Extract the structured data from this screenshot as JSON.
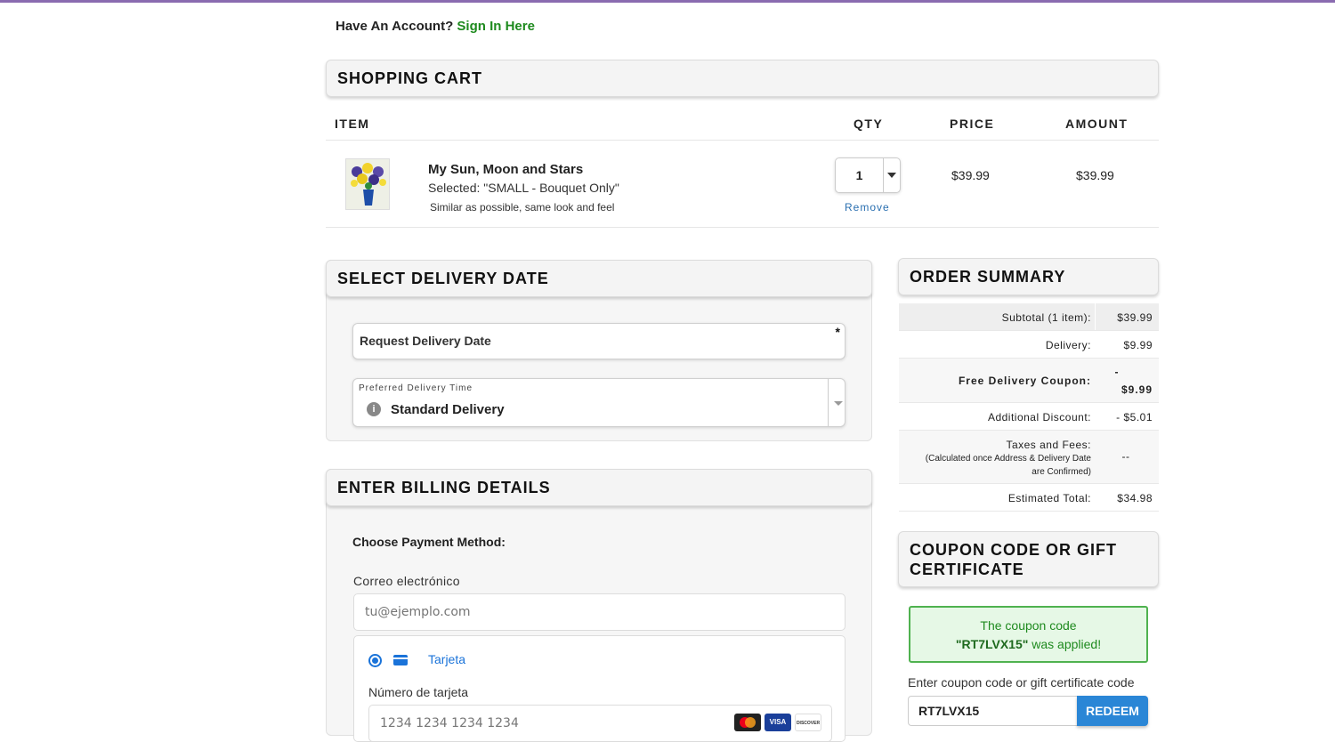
{
  "account": {
    "question": "Have An Account?",
    "link": "Sign In Here"
  },
  "cart": {
    "title": "SHOPPING CART",
    "columns": {
      "item": "ITEM",
      "qty": "QTY",
      "price": "PRICE",
      "amount": "AMOUNT"
    },
    "item": {
      "name": "My Sun, Moon and Stars",
      "selected": "Selected: \"SMALL - Bouquet Only\"",
      "note": "Similar as possible, same look and feel",
      "qty": "1",
      "remove": "Remove",
      "price": "$39.99",
      "amount": "$39.99"
    }
  },
  "delivery": {
    "title": "SELECT DELIVERY DATE",
    "request_label": "Request Delivery Date",
    "required_mark": "*",
    "pref_label": "Preferred Delivery Time",
    "pref_value": "Standard Delivery",
    "info_glyph": "i"
  },
  "billing": {
    "title": "ENTER BILLING DETAILS",
    "choose": "Choose Payment Method:",
    "email_label": "Correo electrónico",
    "email_placeholder": "tu@ejemplo.com",
    "method": "Tarjeta",
    "card_label": "Número de tarjeta",
    "card_placeholder": "1234 1234 1234 1234",
    "brands": {
      "visa": "VISA",
      "discover": "DISCOVER"
    }
  },
  "summary": {
    "title": "ORDER SUMMARY",
    "rows": [
      {
        "label": "Subtotal (1 item):",
        "value": "$39.99"
      },
      {
        "label": "Delivery:",
        "value": "$9.99"
      },
      {
        "label": "Free Delivery Coupon:",
        "value_top": "-",
        "value": "$9.99"
      },
      {
        "label": "Additional Discount:",
        "value": "- $5.01"
      },
      {
        "label": "Taxes and Fees:",
        "sublabel": "(Calculated once Address & Delivery Date are Confirmed)",
        "value": "--"
      },
      {
        "label": "Estimated Total:",
        "value": "$34.98"
      }
    ]
  },
  "coupon": {
    "title": "COUPON CODE OR GIFT CERTIFICATE",
    "msg_pre": "The coupon code",
    "code_quoted": "\"RT7LVX15\"",
    "msg_post": "was applied!",
    "input_label": "Enter coupon code or gift certificate code",
    "input_value": "RT7LVX15",
    "redeem": "REDEEM"
  }
}
